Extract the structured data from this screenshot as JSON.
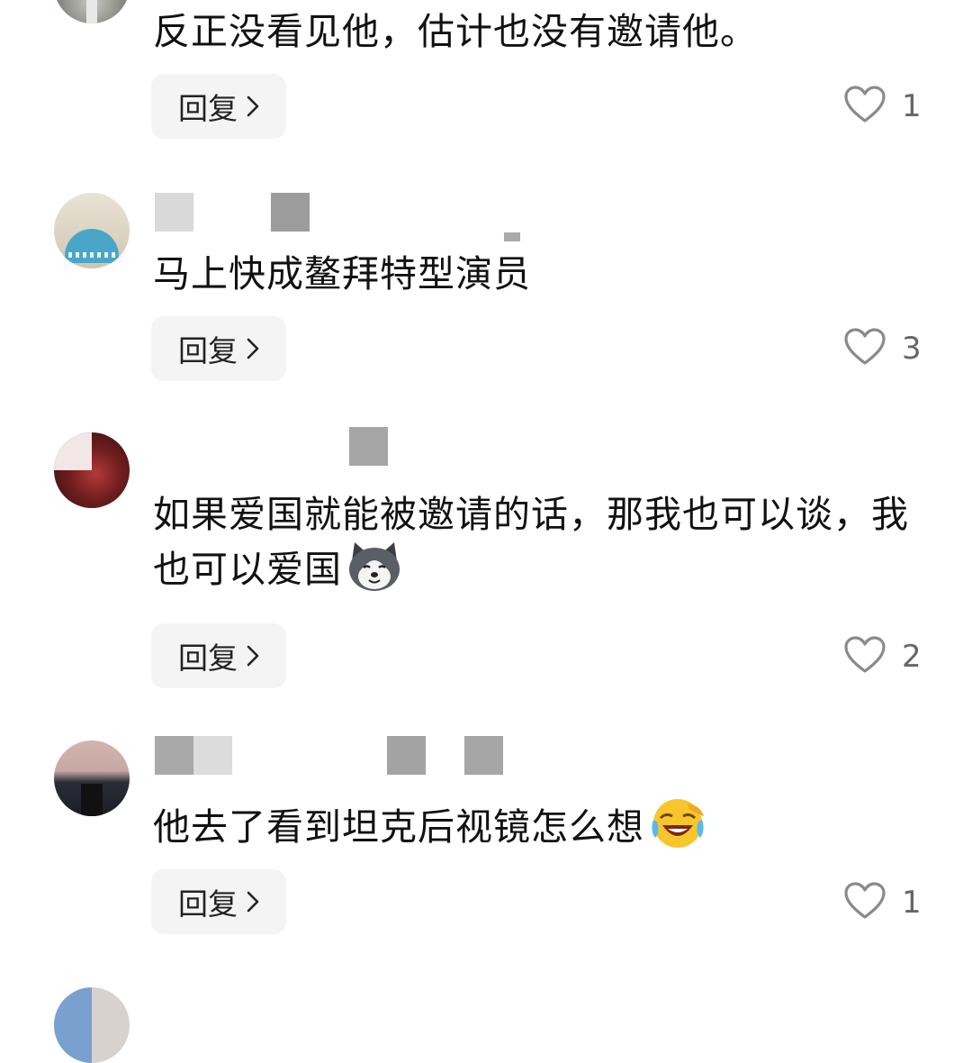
{
  "comments": [
    {
      "username": "",
      "text": "反正没看见他，估计也没有邀请他。",
      "reply_label": "回复",
      "likes": "1"
    },
    {
      "username": "",
      "text": "马上快成鳌拜特型演员",
      "reply_label": "回复",
      "likes": "3"
    },
    {
      "username": "",
      "text": "如果爱国就能被邀请的话，那我也可以谈，我也可以爱国",
      "emoji": "husky-dog-emoji",
      "reply_label": "回复",
      "likes": "2"
    },
    {
      "username": "",
      "text": "他去了看到坦克后视镜怎么想",
      "emoji": "laughing-crying-emoji",
      "reply_label": "回复",
      "likes": "1"
    }
  ],
  "icons": {
    "like": "heart-outline-icon",
    "reply_chevron": "chevron-right-icon"
  },
  "colors": {
    "background": "#ffffff",
    "text": "#111111",
    "reply_button_bg": "#f4f4f4",
    "like_count": "#666666",
    "icon": "#888888"
  }
}
